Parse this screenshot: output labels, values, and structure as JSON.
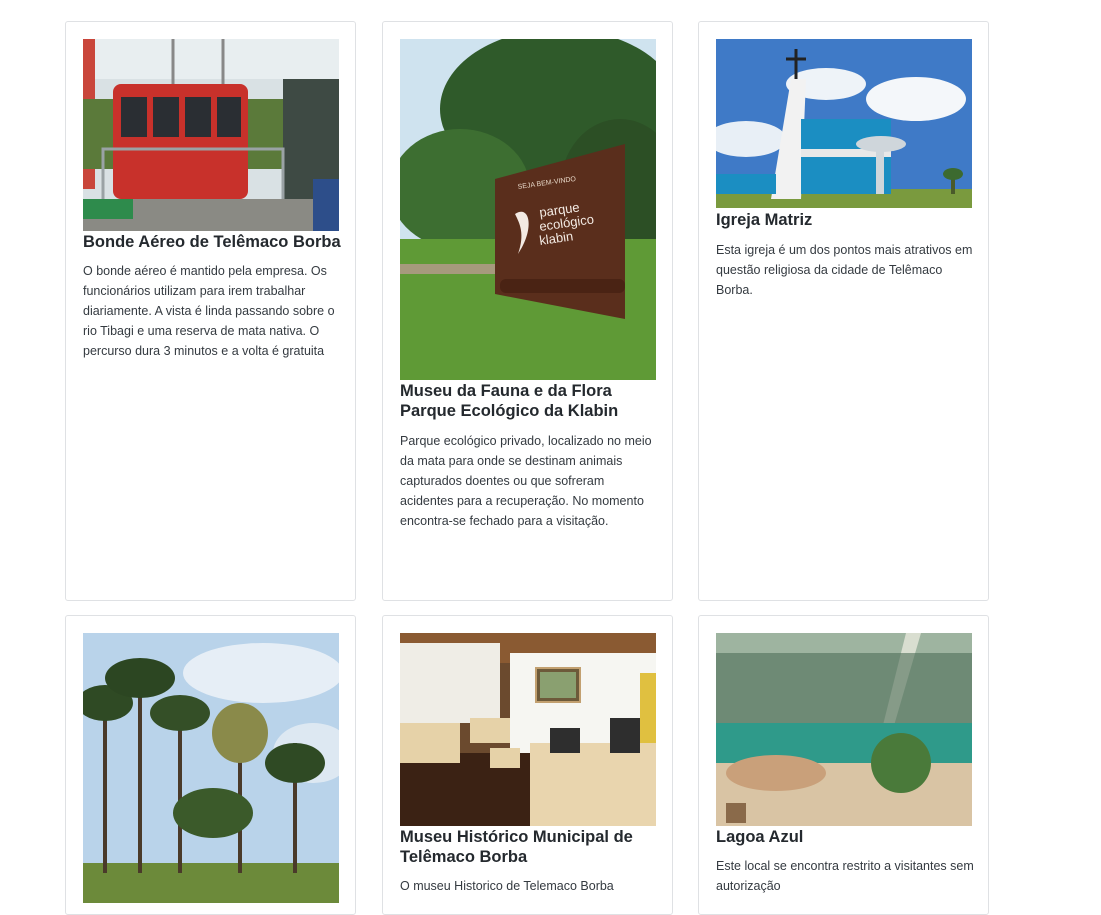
{
  "cards": [
    {
      "title": "Bonde Aéreo de Telêmaco Borba",
      "description": "O bonde aéreo é mantido pela empresa. Os funcionários utilizam para irem trabalhar diariamente. A vista é linda passando sobre o rio Tibagi e uma reserva de mata nativa. O percurso dura 3 minutos e a volta é gratuita",
      "image": "cable-car-photo"
    },
    {
      "title": "Museu da Fauna e da Flora Parque Ecológico da Klabin",
      "description": "Parque ecológico privado, localizado no meio da mata para onde se destinam animais capturados doentes ou que sofreram acidentes para a recuperação. No momento encontra-se fechado para a visitação.",
      "image": "park-sign-photo",
      "sign_text": [
        "SEJA BEM-VINDO",
        "parque",
        "ecológico",
        "klabin"
      ]
    },
    {
      "title": "Igreja Matriz",
      "description": "Esta igreja é um dos pontos mais atrativos em questão religiosa da cidade de Telêmaco Borba.",
      "image": "church-photo"
    },
    {
      "title": "",
      "description": "",
      "image": "araucaria-trees-photo"
    },
    {
      "title": "Museu Histórico Municipal de Telêmaco Borba",
      "description": "O museu Historico de Telemaco Borba",
      "image": "museum-interior-photo"
    },
    {
      "title": "Lagoa Azul",
      "description": "Este local se encontra restrito a visitantes sem autorização",
      "image": "blue-lagoon-photo"
    }
  ]
}
